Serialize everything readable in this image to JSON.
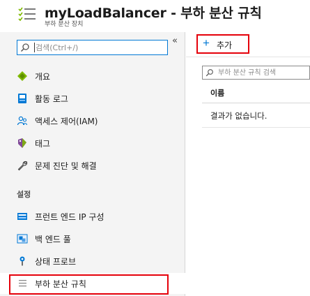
{
  "header": {
    "title": "myLoadBalancer - 부하 분산 규칙",
    "subtitle": "부하 분산 장치",
    "app_icon": "list-icon"
  },
  "sidebar": {
    "collapse_label": "«",
    "search": {
      "placeholder": "검색(Ctrl+/)",
      "value": ""
    },
    "items": [
      {
        "label": "개요",
        "icon": "overview-diamond-icon"
      },
      {
        "label": "활동 로그",
        "icon": "activity-log-icon"
      },
      {
        "label": "액세스 제어(IAM)",
        "icon": "iam-users-icon"
      },
      {
        "label": "태그",
        "icon": "tag-icon"
      },
      {
        "label": "문제 진단 및 해결",
        "icon": "wrench-icon"
      }
    ],
    "section_label": "설정",
    "settings_items": [
      {
        "label": "프런트 엔드 IP 구성",
        "icon": "frontend-ip-icon"
      },
      {
        "label": "백 엔드 풀",
        "icon": "backend-pool-icon"
      },
      {
        "label": "상태 프로브",
        "icon": "health-probe-icon"
      },
      {
        "label": "부하 분산 규칙",
        "icon": "load-balancing-rules-icon",
        "selected": true
      }
    ]
  },
  "content": {
    "add_button": {
      "label": "추가",
      "icon": "plus-icon"
    },
    "filter": {
      "placeholder": "부하 분산 규칙 검색",
      "value": ""
    },
    "table": {
      "columns": [
        "이름"
      ],
      "empty_message": "결과가 없습니다."
    }
  },
  "colors": {
    "accent": "#0078d4",
    "highlight": "#e5000a",
    "sidebar_bg": "#f4f4f4"
  }
}
